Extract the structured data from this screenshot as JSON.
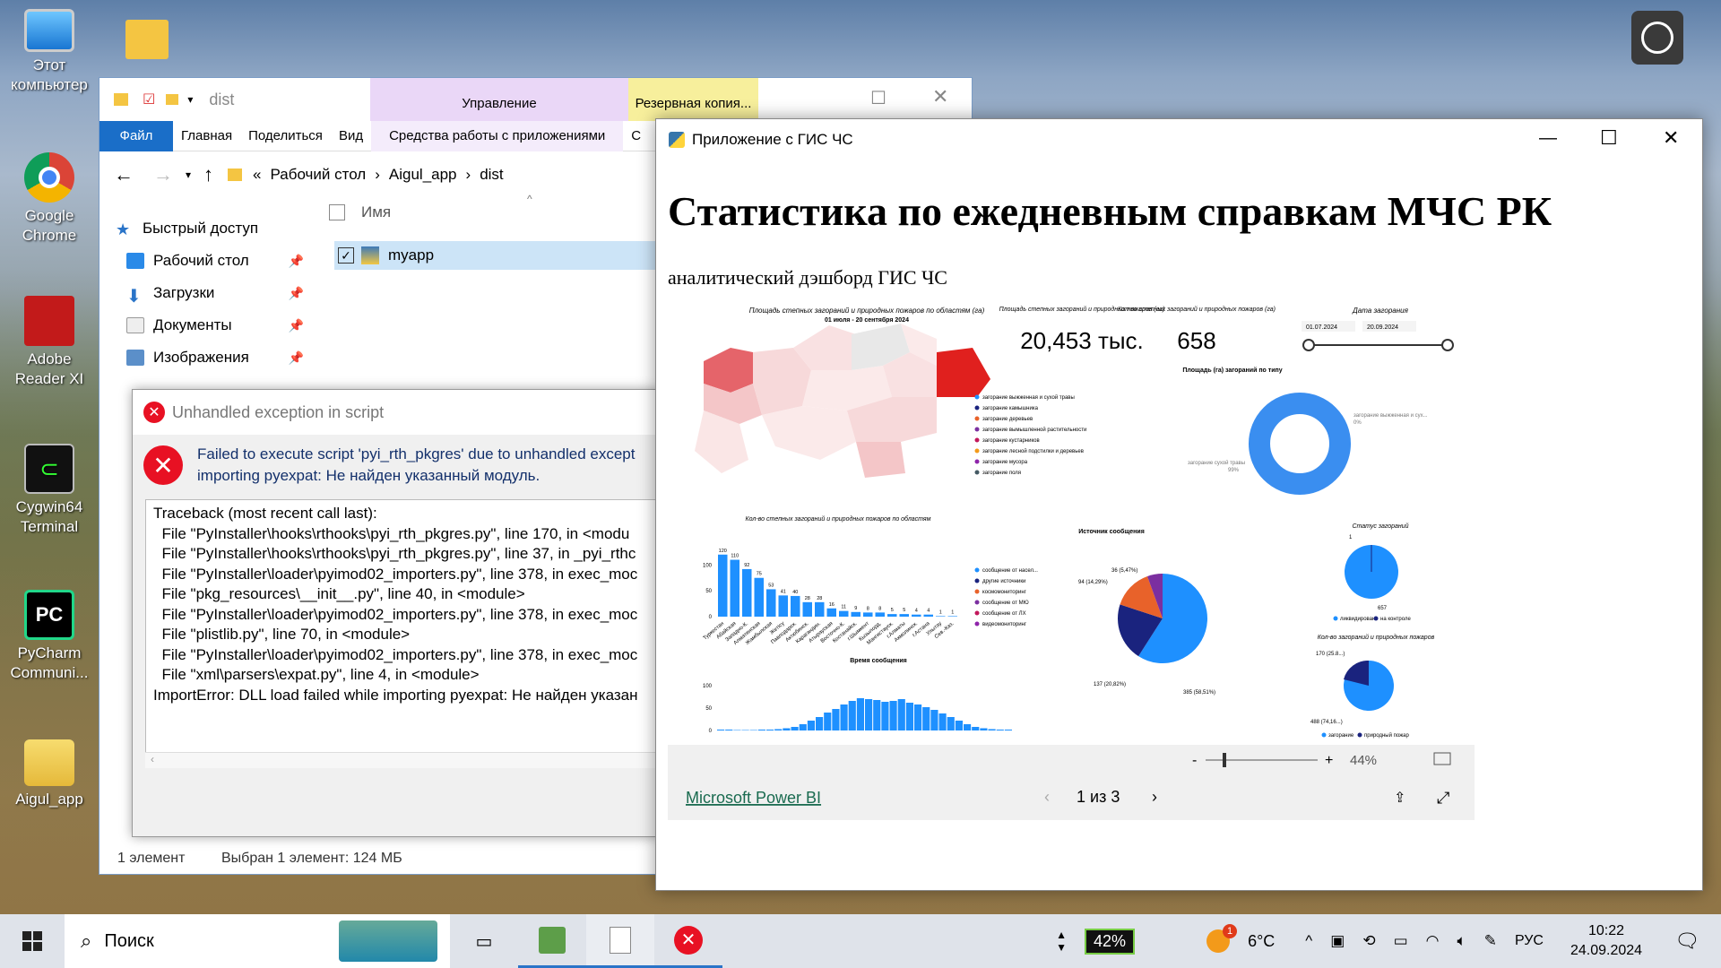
{
  "desktop": {
    "icons": [
      {
        "label": "Этот компьютер"
      },
      {
        "label": "Google Chrome"
      },
      {
        "label": "Adobe Reader XI"
      },
      {
        "label": "Cygwin64 Terminal"
      },
      {
        "label": "PyCharm Communi..."
      },
      {
        "label": "Aigul_app"
      }
    ]
  },
  "explorer": {
    "title": "dist",
    "context_tab_manage": "Управление",
    "context_tab_backup": "Резервная копия...",
    "tabs": [
      "Файл",
      "Главная",
      "Поделиться",
      "Вид",
      "Средства работы с приложениями",
      "С"
    ],
    "breadcrumb": [
      "Рабочий стол",
      "Aigul_app",
      "dist"
    ],
    "breadcrumb_prefix": "«",
    "column_name": "Имя",
    "file": "myapp",
    "nav": [
      {
        "label": "Быстрый доступ"
      },
      {
        "label": "Рабочий стол"
      },
      {
        "label": "Загрузки"
      },
      {
        "label": "Документы"
      },
      {
        "label": "Изображения"
      }
    ],
    "status_count": "1 элемент",
    "status_selected": "Выбран 1 элемент: 124 МБ"
  },
  "dialog": {
    "title": "Unhandled exception in script",
    "message_line1": "Failed to execute script 'pyi_rth_pkgres' due to unhandled except",
    "message_line2": "importing pyexpat: Не найден указанный модуль.",
    "traceback": [
      "Traceback (most recent call last):",
      "  File \"PyInstaller\\hooks\\rthooks\\pyi_rth_pkgres.py\", line 170, in <modu",
      "  File \"PyInstaller\\hooks\\rthooks\\pyi_rth_pkgres.py\", line 37, in _pyi_rthc",
      "  File \"PyInstaller\\loader\\pyimod02_importers.py\", line 378, in exec_moc",
      "  File \"pkg_resources\\__init__.py\", line 40, in <module>",
      "  File \"PyInstaller\\loader\\pyimod02_importers.py\", line 378, in exec_moc",
      "  File \"plistlib.py\", line 70, in <module>",
      "  File \"PyInstaller\\loader\\pyimod02_importers.py\", line 378, in exec_moc",
      "  File \"xml\\parsers\\expat.py\", line 4, in <module>",
      "ImportError: DLL load failed while importing pyexpat: Не найден указан"
    ]
  },
  "app": {
    "title": "Приложение с ГИС ЧС",
    "heading": "Статистика по ежедневным справкам МЧС РК",
    "subheading": "аналитический дэшборд ГИС ЧС",
    "map_title": "Площадь степных загораний и природных пожаров по областям (га)",
    "map_subtitle": "01 июля - 20 сентября 2024",
    "kpi1_title": "Площадь степных загораний и природных пожаров (га)",
    "kpi1_value": "20,453 тыс.",
    "kpi2_title": "Кол-во степных загораний и природных пожаров (га)",
    "kpi2_value": "658",
    "date_title": "Дата загорания",
    "date_from": "01.07.2024",
    "date_to": "20.09.2024",
    "type_chart_title": "Площадь (га) загораний по типу",
    "type_legend": [
      "загорание выжженная и сухой травы",
      "загорание камышника",
      "загорание деревьев",
      "загорание вымышленной растительности",
      "загорание кустарников",
      "загорание лесной подстилки и деревьев",
      "загорание мусора",
      "загорание поля"
    ],
    "donut_label_top": "загорание выжженная и сух...",
    "donut_label_top_pct": "0%",
    "donut_label_bottom": "загорание сухой травы",
    "donut_label_bottom_pct": "99%",
    "zoom": "44%",
    "footer_link": "Microsoft Power BI",
    "pager": "1 из 3",
    "source_title": "Источник сообщения",
    "source_legend": [
      "сообщение от насел...",
      "другие источники",
      "космомониторинг",
      "сообщение от МЮ",
      "сообщение от ЛХ",
      "видеомониторинг"
    ],
    "status_title": "Статус загораний",
    "status_legend": [
      "ликвидирован",
      "на контроле"
    ],
    "status_top_value": "1",
    "status_bottom_value": "657",
    "kind_title": "Кол-во загораний и природных пожаров",
    "kind_legend": [
      "загорание",
      "природный пожар"
    ],
    "kind_label_top": "170 (25.8...)",
    "kind_label_bottom": "488 (74,16...)",
    "time_title": "Время сообщения"
  },
  "taskbar": {
    "search": "Поиск",
    "battery": "42%",
    "weather": "6°C",
    "lang": "РУС",
    "time": "10:22",
    "date": "24.09.2024",
    "notif_count": "1"
  },
  "chart_data": [
    {
      "type": "bar",
      "title": "Кол-во степных загораний и природных пожаров по областям",
      "categories": [
        "Туркестан",
        "Абайская",
        "Западно-К.",
        "Алматинская",
        "Жамбылская",
        "Жетісу",
        "Павлодарск.",
        "Актюбинск.",
        "Карагандин.",
        "Атырауская",
        "Восточно-К.",
        "Костанайск.",
        "г.Шымкент",
        "Кызылорд.",
        "Мангистауск.",
        "г.Алматы",
        "Акмолинск.",
        "г.Астана",
        "Улытау",
        "Сев.-Каз."
      ],
      "values": [
        120,
        110,
        92,
        75,
        53,
        41,
        40,
        28,
        28,
        16,
        11,
        9,
        8,
        8,
        5,
        5,
        4,
        4,
        1,
        1
      ],
      "yticks": [
        0,
        50,
        100
      ],
      "ylim": [
        0,
        130
      ]
    },
    {
      "type": "pie",
      "title": "Источник сообщения",
      "labels": [
        "сообщение от насел...",
        "другие источники",
        "космомониторинг",
        "сообщение от МЮ"
      ],
      "values": [
        385,
        137,
        94,
        36
      ],
      "percent_labels": [
        "385 (58,51%)",
        "137 (20,82%)",
        "94 (14,29%)",
        "36 (5,47%)"
      ],
      "colors": [
        "#1e90ff",
        "#1a237e",
        "#e8622a",
        "#7b2fa0"
      ]
    },
    {
      "type": "area",
      "title": "Время сообщения",
      "yticks": [
        0,
        50,
        100
      ],
      "values": [
        2,
        2,
        1,
        1,
        1,
        2,
        2,
        3,
        5,
        8,
        14,
        22,
        30,
        40,
        48,
        58,
        66,
        72,
        70,
        68,
        64,
        66,
        70,
        62,
        58,
        52,
        46,
        38,
        30,
        22,
        14,
        8,
        5,
        3,
        2,
        2
      ]
    }
  ]
}
